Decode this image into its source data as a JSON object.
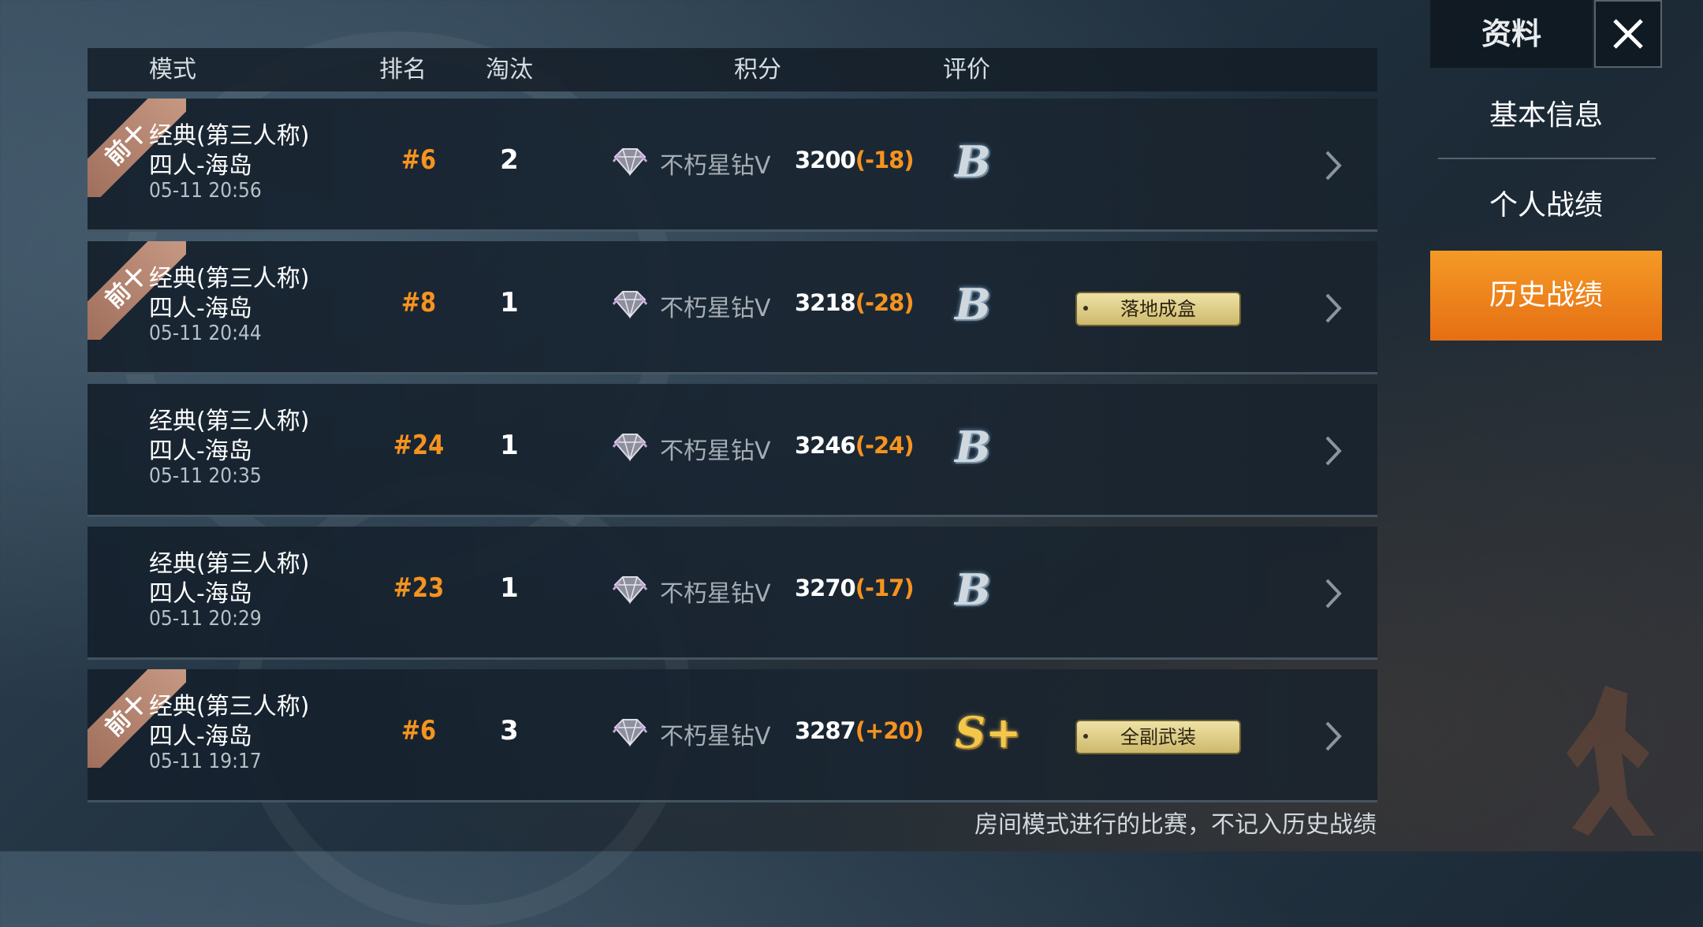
{
  "header": {
    "mode": "模式",
    "rank": "排名",
    "eliminations": "淘汰",
    "score": "积分",
    "rating": "评价"
  },
  "matches": [
    {
      "top_ten": true,
      "top_ten_label": "前十",
      "mode_line1": "经典(第三人称)",
      "mode_line2": "四人-海岛",
      "time": "05-11 20:56",
      "rank": "#6",
      "eliminations": "2",
      "tier": "不朽星钻Ⅴ",
      "score": "3200",
      "delta": "(-18)",
      "grade": "B",
      "badge": ""
    },
    {
      "top_ten": true,
      "top_ten_label": "前十",
      "mode_line1": "经典(第三人称)",
      "mode_line2": "四人-海岛",
      "time": "05-11 20:44",
      "rank": "#8",
      "eliminations": "1",
      "tier": "不朽星钻Ⅴ",
      "score": "3218",
      "delta": "(-28)",
      "grade": "B",
      "badge": "落地成盒"
    },
    {
      "top_ten": false,
      "top_ten_label": "",
      "mode_line1": "经典(第三人称)",
      "mode_line2": "四人-海岛",
      "time": "05-11 20:35",
      "rank": "#24",
      "eliminations": "1",
      "tier": "不朽星钻Ⅴ",
      "score": "3246",
      "delta": "(-24)",
      "grade": "B",
      "badge": ""
    },
    {
      "top_ten": false,
      "top_ten_label": "",
      "mode_line1": "经典(第三人称)",
      "mode_line2": "四人-海岛",
      "time": "05-11 20:29",
      "rank": "#23",
      "eliminations": "1",
      "tier": "不朽星钻Ⅴ",
      "score": "3270",
      "delta": "(-17)",
      "grade": "B",
      "badge": ""
    },
    {
      "top_ten": true,
      "top_ten_label": "前十",
      "mode_line1": "经典(第三人称)",
      "mode_line2": "四人-海岛",
      "time": "05-11 19:17",
      "rank": "#6",
      "eliminations": "3",
      "tier": "不朽星钻Ⅴ",
      "score": "3287",
      "delta": "(+20)",
      "grade": "S+",
      "badge": "全副武装"
    }
  ],
  "sidebar": {
    "title": "资料",
    "items": [
      {
        "label": "基本信息",
        "active": false
      },
      {
        "label": "个人战绩",
        "active": false
      },
      {
        "label": "历史战绩",
        "active": true
      }
    ]
  },
  "footnote": "房间模式进行的比赛，不记入历史战绩",
  "colors": {
    "accent": "#f6931f",
    "active_tab": "#f0861e",
    "badge": "#e3d38e"
  }
}
